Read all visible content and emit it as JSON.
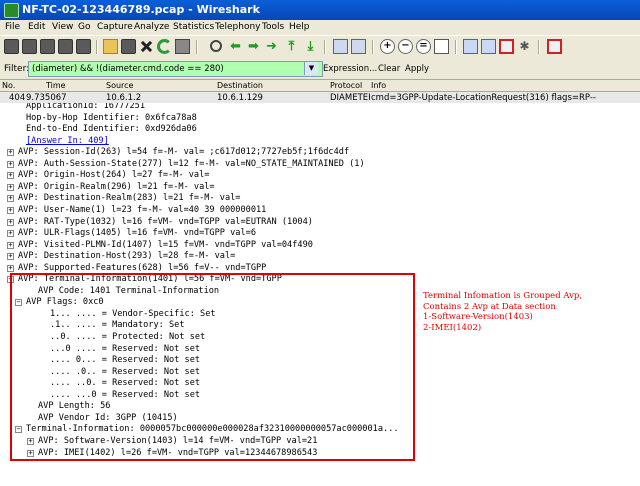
{
  "window": {
    "title": "NF-TC-02-123446789.pcap - Wireshark"
  },
  "menu": [
    "File",
    "Edit",
    "View",
    "Go",
    "Capture",
    "Analyze",
    "Statistics",
    "Telephony",
    "Tools",
    "Help"
  ],
  "filter": {
    "label": "Filter:",
    "value": "(diameter) && !(diameter.cmd.code == 280)",
    "expression_label": "Expression...",
    "clear_label": "Clear",
    "apply_label": "Apply"
  },
  "packet_list": {
    "columns": [
      "No.",
      "Time",
      "Source",
      "Destination",
      "Protocol",
      "Info"
    ],
    "row": {
      "no": "404",
      "time": "9.735067",
      "source": "10.6.1.2",
      "destination": "10.6.1.129",
      "protocol": "DIAMETER",
      "info": "cmd=3GPP-Update-LocationRequest(316) flags=RP--"
    }
  },
  "details": {
    "lines": [
      {
        "text": "ApplicationId: 16777251",
        "indent": 2,
        "expander": ""
      },
      {
        "text": "Hop-by-Hop Identifier: 0x6fca78a8",
        "indent": 2,
        "expander": ""
      },
      {
        "text": "End-to-End Identifier: 0xd926da06",
        "indent": 2,
        "expander": ""
      },
      {
        "text": "[Answer In: 409]",
        "indent": 2,
        "expander": "",
        "link": true
      },
      {
        "text": "AVP: Session-Id(263) l=54 f=-M- val=                  ;c617d012;7727eb5f;1f6dc4df",
        "indent": 1,
        "expander": "+"
      },
      {
        "text": "AVP: Auth-Session-State(277) l=12 f=-M- val=NO_STATE_MAINTAINED (1)",
        "indent": 1,
        "expander": "+"
      },
      {
        "text": "AVP: Origin-Host(264) l=27 f=-M- val=",
        "indent": 1,
        "expander": "+"
      },
      {
        "text": "AVP: Origin-Realm(296) l=21 f=-M- val=",
        "indent": 1,
        "expander": "+"
      },
      {
        "text": "AVP: Destination-Realm(283) l=21 f=-M- val=",
        "indent": 1,
        "expander": "+"
      },
      {
        "text": "AVP: User-Name(1) l=23 f=-M- val=40 39 000000011",
        "indent": 1,
        "expander": "+"
      },
      {
        "text": "AVP: RAT-Type(1032) l=16 f=VM- vnd=TGPP val=EUTRAN (1004)",
        "indent": 1,
        "expander": "+"
      },
      {
        "text": "AVP: ULR-Flags(1405) l=16 f=VM- vnd=TGPP val=6",
        "indent": 1,
        "expander": "+"
      },
      {
        "text": "AVP: Visited-PLMN-Id(1407) l=15 f=VM- vnd=TGPP val=04f490",
        "indent": 1,
        "expander": "+"
      },
      {
        "text": "AVP: Destination-Host(293) l=28 f=-M- val=",
        "indent": 1,
        "expander": "+"
      },
      {
        "text": "AVP: Supported-Features(628) l=56 f=V-- vnd=TGPP",
        "indent": 1,
        "expander": "+"
      },
      {
        "text": "AVP: Terminal-Information(1401) l=56 f=VM- vnd=TGPP",
        "indent": 1,
        "expander": "-"
      },
      {
        "text": "AVP Code: 1401 Terminal-Information",
        "indent": 3,
        "expander": ""
      },
      {
        "text": "AVP Flags: 0xc0",
        "indent": 2,
        "expander": "-"
      },
      {
        "text": "1... .... = Vendor-Specific: Set",
        "indent": 4,
        "expander": ""
      },
      {
        "text": ".1.. .... = Mandatory: Set",
        "indent": 4,
        "expander": ""
      },
      {
        "text": "..0. .... = Protected: Not set",
        "indent": 4,
        "expander": ""
      },
      {
        "text": "...0 .... = Reserved: Not set",
        "indent": 4,
        "expander": ""
      },
      {
        "text": ".... 0... = Reserved: Not set",
        "indent": 4,
        "expander": ""
      },
      {
        "text": ".... .0.. = Reserved: Not set",
        "indent": 4,
        "expander": ""
      },
      {
        "text": ".... ..0. = Reserved: Not set",
        "indent": 4,
        "expander": ""
      },
      {
        "text": ".... ...0 = Reserved: Not set",
        "indent": 4,
        "expander": ""
      },
      {
        "text": "AVP Length: 56",
        "indent": 3,
        "expander": ""
      },
      {
        "text": "AVP Vendor Id: 3GPP (10415)",
        "indent": 3,
        "expander": ""
      },
      {
        "text": "Terminal-Information: 0000057bc000000e000028af32310000000057ac000001a...",
        "indent": 2,
        "expander": "-"
      },
      {
        "text": "AVP: Software-Version(1403) l=14 f=VM- vnd=TGPP val=21",
        "indent": 3,
        "expander": "+"
      },
      {
        "text": "AVP: IMEI(1402) l=26 f=VM- vnd=TGPP val=12344678986543",
        "indent": 3,
        "expander": "+"
      }
    ]
  },
  "annotation": {
    "text": "Terminal Infomation is Grouped Avp,\nContains 2 Avp at Data section\n1-Software-Version(1403)\n2-IMEI(1402)"
  },
  "colors": {
    "titlebar": "#0846b8",
    "chrome": "#ece9d8",
    "filter_ok": "#afffaf",
    "highlight_box": "#e00000",
    "link": "#0000ee"
  }
}
